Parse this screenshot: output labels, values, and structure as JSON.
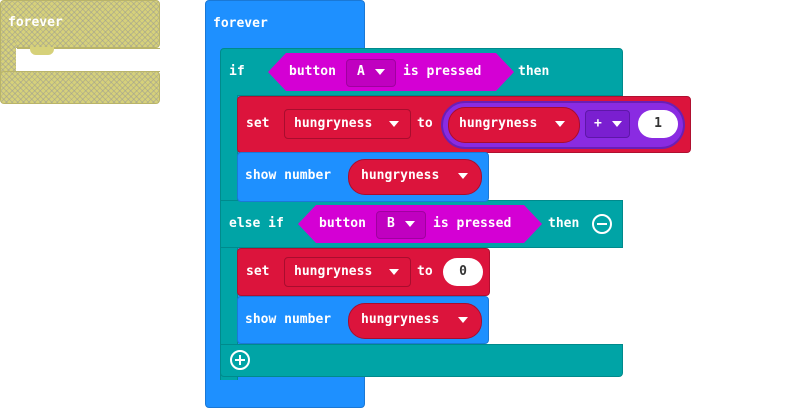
{
  "ghost_block": {
    "label": "forever"
  },
  "forever_block": {
    "label": "forever"
  },
  "if_block": {
    "if_label": "if",
    "then_label": "then",
    "condition": {
      "button_label": "button",
      "button_value": "A",
      "pressed_label": "is pressed"
    },
    "set_block": {
      "set_label": "set",
      "variable": "hungryness",
      "to_label": "to",
      "math": {
        "left_variable": "hungryness",
        "operator": "+",
        "right_value": "1"
      }
    },
    "show_block": {
      "label": "show number",
      "variable": "hungryness"
    },
    "else_if_label": "else if",
    "else_if_then_label": "then",
    "else_condition": {
      "button_label": "button",
      "button_value": "B",
      "pressed_label": "is pressed"
    },
    "set_block_2": {
      "set_label": "set",
      "variable": "hungryness",
      "to_label": "to",
      "value": "0"
    },
    "show_block_2": {
      "label": "show number",
      "variable": "hungryness"
    }
  },
  "colors": {
    "loops": "#1e90ff",
    "logic": "#00a4a6",
    "variables": "#dc143c",
    "input": "#d400d4",
    "math": "#8a2be2",
    "disabled": "#d6d17a"
  },
  "icons": {
    "dropdown": "chevron-down-icon",
    "remove_branch": "minus-circle-icon",
    "add_branch": "plus-circle-icon"
  }
}
